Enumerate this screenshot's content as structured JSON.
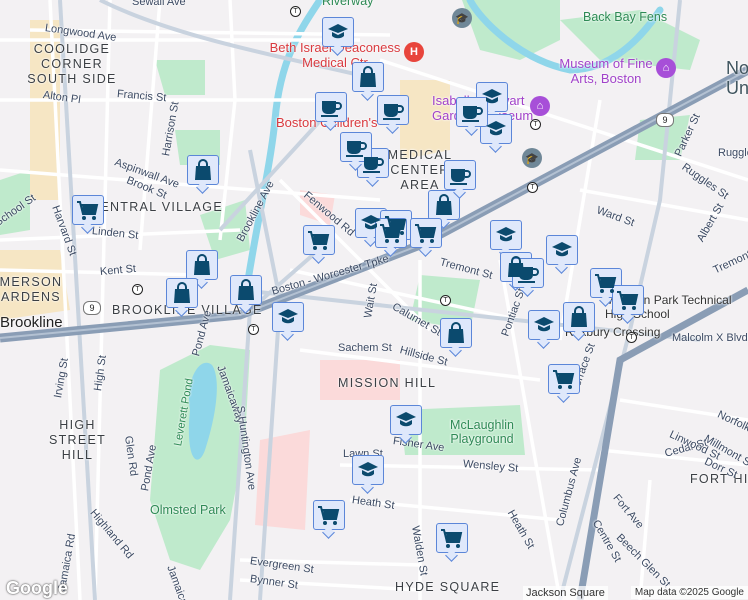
{
  "map": {
    "labels": [
      "Sewall Ave",
      "Longwood Ave",
      "COOLIDGE CORNER SOUTH SIDE",
      "Alton Pl",
      "Francis St",
      "Harrison St",
      "Aspinwall Ave",
      "Brook St",
      "CENTRAL VILLAGE",
      "School St",
      "Harvard St",
      "Linden St",
      "Kent St",
      "EMERSON GARDENS",
      "Brookline",
      "BROOKLINE VILLAGE",
      "Brookline Ave",
      "Fenwood Rd",
      "Boston - Worcester Tpke",
      "Tremont St",
      "Beth Israel Deaconess Medical Ctr",
      "Boston Children's",
      "MEDICAL CENTER AREA",
      "Isabella Stewart Gardner Museum",
      "Museum of Fine Arts, Boston",
      "Back Bay Fens",
      "Riverway",
      "Parker St",
      "Ruggles St",
      "Ward St",
      "Albert St",
      "Wait St",
      "Calumet St",
      "Pontiac St",
      "Madison Park Technical High School",
      "Malcolm X Blvd",
      "Roxbury Crossing",
      "Sachem St",
      "Hillside St",
      "MISSION HILL",
      "McLaughlin Playground",
      "Fisher Ave",
      "Wensley St",
      "Heath St",
      "Cedar St",
      "FORT HILL",
      "Linwood St",
      "Millmont St",
      "Dorr St",
      "Fort Ave",
      "Centre St",
      "Beech Glen St",
      "Columbus Ave",
      "Terrace St",
      "Lawn St",
      "Heath St",
      "Walden St",
      "Evergreen St",
      "Bynner St",
      "HYDE SQUARE",
      "Olmsted Park",
      "Leverett Pond",
      "Pond Ave",
      "Pond Ave",
      "Jamaicaway",
      "Jamaicaway",
      "S Huntington Ave",
      "Glen Rd",
      "HIGH STREET HILL",
      "High St",
      "Irving St",
      "Highland Rd",
      "Jamaica Rd",
      "Northeastern University",
      "Ruggles",
      "Norfolk",
      "Tremont"
    ],
    "markers": [
      "school",
      "school",
      "school",
      "school",
      "school",
      "school",
      "school",
      "school",
      "school",
      "school",
      "shop",
      "shop",
      "shop",
      "shop",
      "shop",
      "shop",
      "shop",
      "shop",
      "shop",
      "cafe",
      "cafe",
      "cafe",
      "cafe",
      "cafe",
      "cafe",
      "cafe",
      "cart",
      "cart",
      "cart",
      "cart",
      "cart",
      "cart",
      "cart",
      "cart",
      "cart",
      "cart"
    ],
    "route_shield": "9",
    "hospital_icon": "H",
    "transit_symbol": "T",
    "jackson_square": "Jackson Square",
    "attribution": "Map data ©2025 Google",
    "logo": "Google",
    "colors": {
      "marker_fill": "#dfe8fb",
      "marker_border": "#5b86d8",
      "icon": "#0b4a6e",
      "park": "#bfeacc",
      "water": "#8fd6ea",
      "highway": "#8a9db5"
    }
  }
}
